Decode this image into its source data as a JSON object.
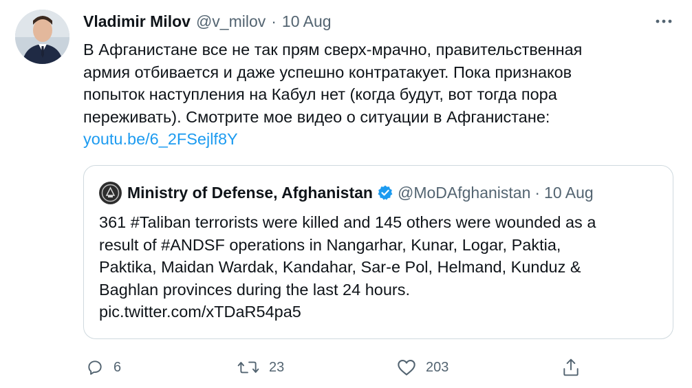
{
  "author": {
    "name": "Vladimir Milov",
    "handle": "@v_milov",
    "separator": "·",
    "date": "10 Aug"
  },
  "tweet": {
    "lines": [
      "В Афганистане все не так прям сверх-мрачно, правительственная",
      "армия отбивается и даже успешно контратакует. Пока признаков",
      "попыток наступления на Кабул нет (когда будут, вот тогда пора",
      "переживать). Смотрите мое видео о ситуации в Афганистане:"
    ],
    "link": "youtu.be/6_2FSejlf8Y"
  },
  "quoted": {
    "name": "Ministry of Defense, Afghanistan",
    "handle": "@MoDAfghanistan",
    "separator": "·",
    "date": "10 Aug",
    "lines": [
      "361 #Taliban terrorists were killed and 145 others were wounded as a",
      "result of #ANDSF operations in Nangarhar, Kunar, Logar, Paktia,",
      "Paktika, Maidan Wardak, Kandahar, Sar-e Pol, Helmand, Kunduz &",
      "Baghlan provinces during the last 24 hours.",
      "pic.twitter.com/xTDaR54pa5"
    ]
  },
  "actions": {
    "reply_count": "6",
    "retweet_count": "23",
    "like_count": "203"
  },
  "colors": {
    "text": "#0f1419",
    "muted": "#536471",
    "link": "#1d9bf0",
    "border": "#cfd9de",
    "verified": "#1d9bf0"
  },
  "icons": [
    "more-icon",
    "verified-icon",
    "reply-icon",
    "retweet-icon",
    "like-icon",
    "share-icon"
  ]
}
